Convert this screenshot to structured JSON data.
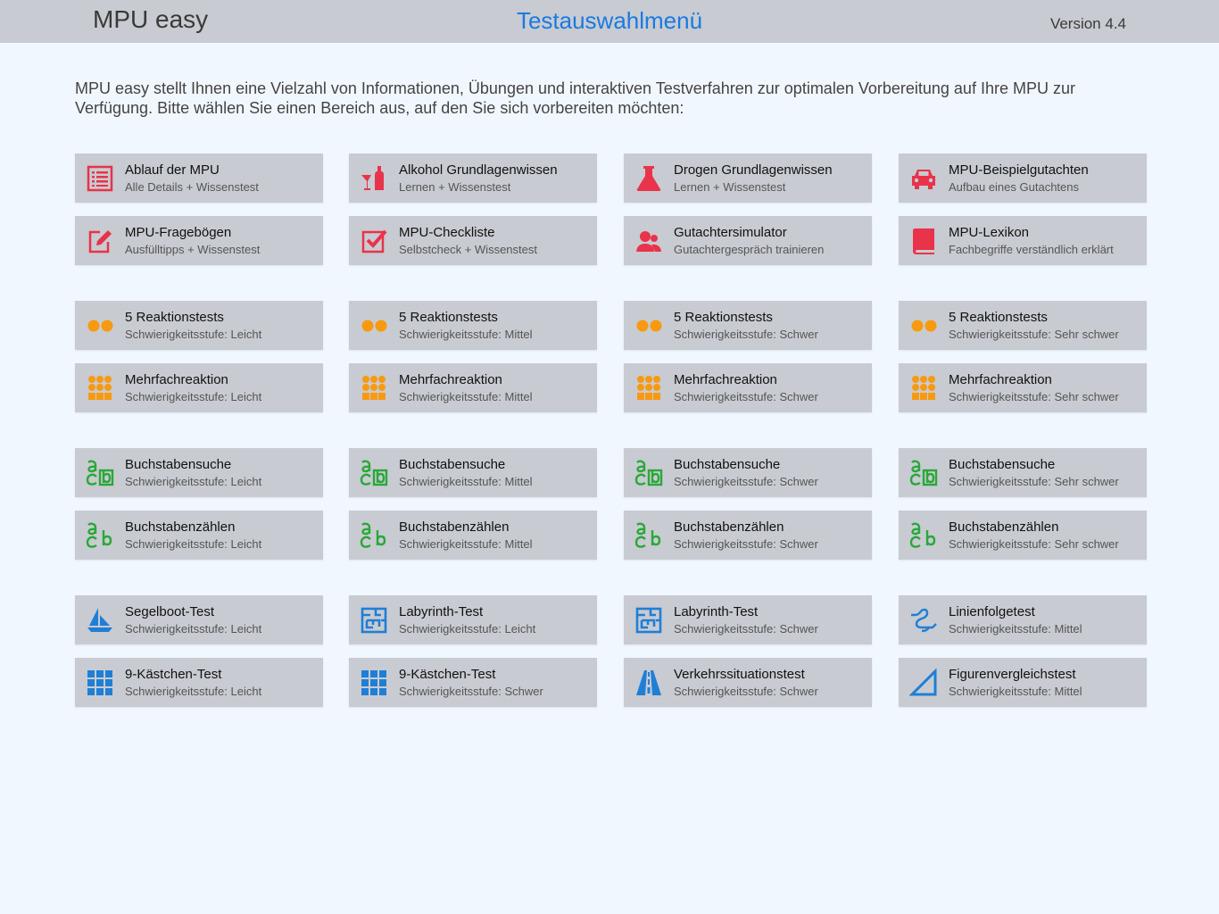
{
  "header": {
    "app_name": "MPU easy",
    "title": "Testauswahlmenü",
    "version": "Version 4.4"
  },
  "intro": "MPU easy stellt Ihnen eine Vielzahl von Informationen, Übungen und interaktiven Testverfahren zur optimalen Vorbereitung auf Ihre MPU zur Verfügung. Bitte wählen Sie einen Bereich aus, auf den Sie sich vorbereiten möchten:",
  "colors": {
    "accent": "#1a7ae2",
    "red": "#e8334a",
    "orange": "#f79a10",
    "green": "#2aa838",
    "blue": "#1f7fd6"
  },
  "tiles": [
    {
      "title": "Ablauf der MPU",
      "subtitle": "Alle Details + Wissenstest",
      "icon": "list-icon"
    },
    {
      "title": "Alkohol Grundlagenwissen",
      "subtitle": "Lernen + Wissenstest",
      "icon": "bottle-glass-icon"
    },
    {
      "title": "Drogen Grundlagenwissen",
      "subtitle": "Lernen + Wissenstest",
      "icon": "flask-icon"
    },
    {
      "title": "MPU-Beispielgutachten",
      "subtitle": "Aufbau eines Gutachtens",
      "icon": "car-icon"
    },
    {
      "title": "MPU-Fragebögen",
      "subtitle": "Ausfülltipps + Wissenstest",
      "icon": "edit-icon"
    },
    {
      "title": "MPU-Checkliste",
      "subtitle": "Selbstcheck + Wissenstest",
      "icon": "checkbox-icon"
    },
    {
      "title": "Gutachtersimulator",
      "subtitle": "Gutachtergespräch trainieren",
      "icon": "users-icon"
    },
    {
      "title": "MPU-Lexikon",
      "subtitle": "Fachbegriffe verständlich erklärt",
      "icon": "book-icon"
    },
    {
      "title": "5 Reaktionstests",
      "subtitle": "Schwierigkeitsstufe: Leicht",
      "icon": "two-dots-icon"
    },
    {
      "title": "5 Reaktionstests",
      "subtitle": "Schwierigkeitsstufe: Mittel",
      "icon": "two-dots-icon"
    },
    {
      "title": "5 Reaktionstests",
      "subtitle": "Schwierigkeitsstufe: Schwer",
      "icon": "two-dots-icon"
    },
    {
      "title": "5 Reaktionstests",
      "subtitle": "Schwierigkeitsstufe: Sehr schwer",
      "icon": "two-dots-icon"
    },
    {
      "title": "Mehrfachreaktion",
      "subtitle": "Schwierigkeitsstufe: Leicht",
      "icon": "dot-grid-icon"
    },
    {
      "title": "Mehrfachreaktion",
      "subtitle": "Schwierigkeitsstufe: Mittel",
      "icon": "dot-grid-icon"
    },
    {
      "title": "Mehrfachreaktion",
      "subtitle": "Schwierigkeitsstufe: Schwer",
      "icon": "dot-grid-icon"
    },
    {
      "title": "Mehrfachreaktion",
      "subtitle": "Schwierigkeitsstufe: Sehr schwer",
      "icon": "dot-grid-icon"
    },
    {
      "title": "Buchstabensuche",
      "subtitle": "Schwierigkeitsstufe: Leicht",
      "icon": "letters-box-icon"
    },
    {
      "title": "Buchstabensuche",
      "subtitle": "Schwierigkeitsstufe: Mittel",
      "icon": "letters-box-icon"
    },
    {
      "title": "Buchstabensuche",
      "subtitle": "Schwierigkeitsstufe: Schwer",
      "icon": "letters-box-icon"
    },
    {
      "title": "Buchstabensuche",
      "subtitle": "Schwierigkeitsstufe: Sehr schwer",
      "icon": "letters-box-icon"
    },
    {
      "title": "Buchstabenzählen",
      "subtitle": "Schwierigkeitsstufe: Leicht",
      "icon": "letters-icon"
    },
    {
      "title": "Buchstabenzählen",
      "subtitle": "Schwierigkeitsstufe: Mittel",
      "icon": "letters-icon"
    },
    {
      "title": "Buchstabenzählen",
      "subtitle": "Schwierigkeitsstufe: Schwer",
      "icon": "letters-icon"
    },
    {
      "title": "Buchstabenzählen",
      "subtitle": "Schwierigkeitsstufe: Sehr schwer",
      "icon": "letters-icon"
    },
    {
      "title": "Segelboot-Test",
      "subtitle": "Schwierigkeitsstufe: Leicht",
      "icon": "sailboat-icon"
    },
    {
      "title": "Labyrinth-Test",
      "subtitle": "Schwierigkeitsstufe: Leicht",
      "icon": "maze-icon"
    },
    {
      "title": "Labyrinth-Test",
      "subtitle": "Schwierigkeitsstufe: Schwer",
      "icon": "maze-icon"
    },
    {
      "title": "Linienfolgetest",
      "subtitle": "Schwierigkeitsstufe: Mittel",
      "icon": "line-path-icon"
    },
    {
      "title": "9-Kästchen-Test",
      "subtitle": "Schwierigkeitsstufe: Leicht",
      "icon": "grid-icon"
    },
    {
      "title": "9-Kästchen-Test",
      "subtitle": "Schwierigkeitsstufe: Schwer",
      "icon": "grid-icon"
    },
    {
      "title": "Verkehrssituationstest",
      "subtitle": "Schwierigkeitsstufe: Schwer",
      "icon": "road-icon"
    },
    {
      "title": "Figurenvergleichstest",
      "subtitle": "Schwierigkeitsstufe: Mittel",
      "icon": "triangle-icon"
    }
  ]
}
